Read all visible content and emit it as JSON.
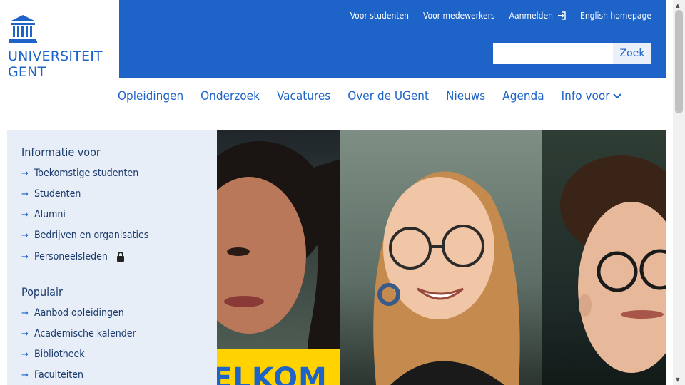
{
  "logo": {
    "line1": "UNIVERSITEIT",
    "line2": "GENT"
  },
  "toplinks": [
    "Voor studenten",
    "Voor medewerkers",
    "Aanmelden",
    "English homepage"
  ],
  "search": {
    "placeholder": "",
    "button": "Zoek"
  },
  "mainnav": [
    "Opleidingen",
    "Onderzoek",
    "Vacatures",
    "Over de UGent",
    "Nieuws",
    "Agenda",
    "Info voor"
  ],
  "sidebar": {
    "heading1": "Informatie voor",
    "items1": [
      "Toekomstige studenten",
      "Studenten",
      "Alumni",
      "Bedrijven en organisaties",
      "Personeelsleden"
    ],
    "heading2": "Populair",
    "items2": [
      "Aanbod opleidingen",
      "Academische kalender",
      "Bibliotheek",
      "Faculteiten"
    ]
  },
  "hero": {
    "banner_text": "ELKOM"
  },
  "colors": {
    "brand": "#1e64c8",
    "sidebar_bg": "#e8eef8",
    "banner": "#ffd200"
  }
}
